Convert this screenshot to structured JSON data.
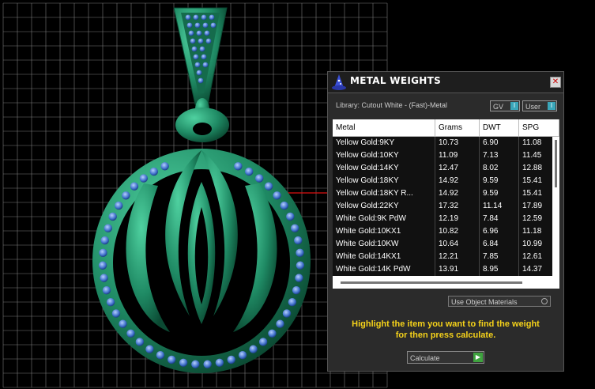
{
  "window": {
    "title": "METAL WEIGHTS",
    "close_label": "✕"
  },
  "library": {
    "label": "Library: Cutout White - (Fast)-Metal",
    "gv_label": "GV",
    "user_label": "User"
  },
  "table": {
    "columns": [
      "Metal",
      "Grams",
      "DWT",
      "SPG"
    ],
    "rows": [
      [
        "Yellow Gold:9KY",
        "10.73",
        "6.90",
        "11.08"
      ],
      [
        "Yellow Gold:10KY",
        "11.09",
        "7.13",
        "11.45"
      ],
      [
        "Yellow Gold:14KY",
        "12.47",
        "8.02",
        "12.88"
      ],
      [
        "Yellow Gold:18KY",
        "14.92",
        "9.59",
        "15.41"
      ],
      [
        "Yellow Gold:18KY R...",
        "14.92",
        "9.59",
        "15.41"
      ],
      [
        "Yellow Gold:22KY",
        "17.32",
        "11.14",
        "17.89"
      ],
      [
        "White Gold:9K PdW",
        "12.19",
        "7.84",
        "12.59"
      ],
      [
        "White Gold:10KX1",
        "10.82",
        "6.96",
        "11.18"
      ],
      [
        "White Gold:10KW",
        "10.64",
        "6.84",
        "10.99"
      ],
      [
        "White Gold:14KX1",
        "12.21",
        "7.85",
        "12.61"
      ],
      [
        "White Gold:14K PdW",
        "13.91",
        "8.95",
        "14.37"
      ]
    ]
  },
  "options": {
    "use_object_materials_label": "Use Object Materials"
  },
  "hint": {
    "line1": "Highlight the item you want to find the weight",
    "line2": "for then press calculate."
  },
  "calculate": {
    "label": "Calculate"
  },
  "colors": {
    "grid": "#7a7a7a",
    "pendant": "#1f8a64",
    "gems": "#4a7fd6",
    "hint_text": "#f5d21a",
    "toggle_accent": "#3aa6b9",
    "calc_arrow": "#3fa33f"
  }
}
